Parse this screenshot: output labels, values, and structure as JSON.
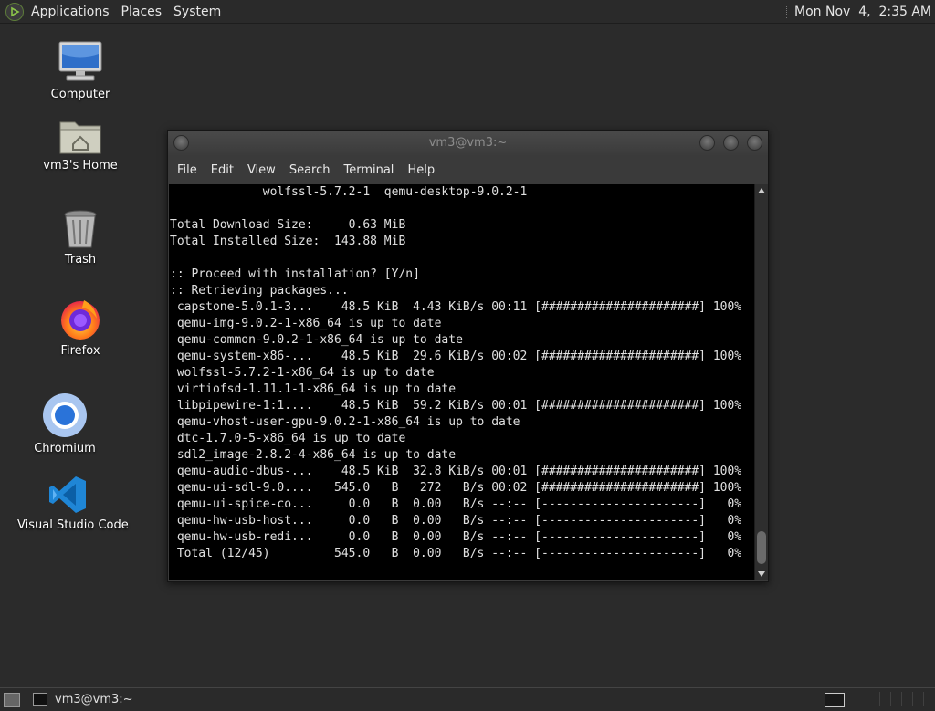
{
  "top_panel": {
    "menus": [
      "Applications",
      "Places",
      "System"
    ],
    "clock": "Mon Nov  4,  2:35 AM"
  },
  "desktop_icons": [
    {
      "label": "Computer",
      "icon": "computer-icon"
    },
    {
      "label": "vm3's Home",
      "icon": "home-folder-icon"
    },
    {
      "label": "Trash",
      "icon": "trash-icon"
    },
    {
      "label": "Firefox",
      "icon": "firefox-icon"
    },
    {
      "label": "Chromium",
      "icon": "chromium-icon"
    },
    {
      "label": "Visual Studio Code",
      "icon": "vscode-icon"
    }
  ],
  "terminal": {
    "title": "vm3@vm3:~",
    "menu": [
      "File",
      "Edit",
      "View",
      "Search",
      "Terminal",
      "Help"
    ],
    "lines": [
      "             wolfssl-5.7.2-1  qemu-desktop-9.0.2-1",
      "",
      "Total Download Size:     0.63 MiB",
      "Total Installed Size:  143.88 MiB",
      "",
      ":: Proceed with installation? [Y/n]",
      ":: Retrieving packages...",
      " capstone-5.0.1-3...    48.5 KiB  4.43 KiB/s 00:11 [######################] 100%",
      " qemu-img-9.0.2-1-x86_64 is up to date",
      " qemu-common-9.0.2-1-x86_64 is up to date",
      " qemu-system-x86-...    48.5 KiB  29.6 KiB/s 00:02 [######################] 100%",
      " wolfssl-5.7.2-1-x86_64 is up to date",
      " virtiofsd-1.11.1-1-x86_64 is up to date",
      " libpipewire-1:1....    48.5 KiB  59.2 KiB/s 00:01 [######################] 100%",
      " qemu-vhost-user-gpu-9.0.2-1-x86_64 is up to date",
      " dtc-1.7.0-5-x86_64 is up to date",
      " sdl2_image-2.8.2-4-x86_64 is up to date",
      " qemu-audio-dbus-...    48.5 KiB  32.8 KiB/s 00:01 [######################] 100%",
      " qemu-ui-sdl-9.0....   545.0   B   272   B/s 00:02 [######################] 100%",
      " qemu-ui-spice-co...     0.0   B  0.00   B/s --:-- [----------------------]   0%",
      " qemu-hw-usb-host...     0.0   B  0.00   B/s --:-- [----------------------]   0%",
      " qemu-hw-usb-redi...     0.0   B  0.00   B/s --:-- [----------------------]   0%",
      " Total (12/45)         545.0   B  0.00   B/s --:-- [----------------------]   0%"
    ]
  },
  "taskbar": {
    "task_label": "vm3@vm3:~"
  }
}
